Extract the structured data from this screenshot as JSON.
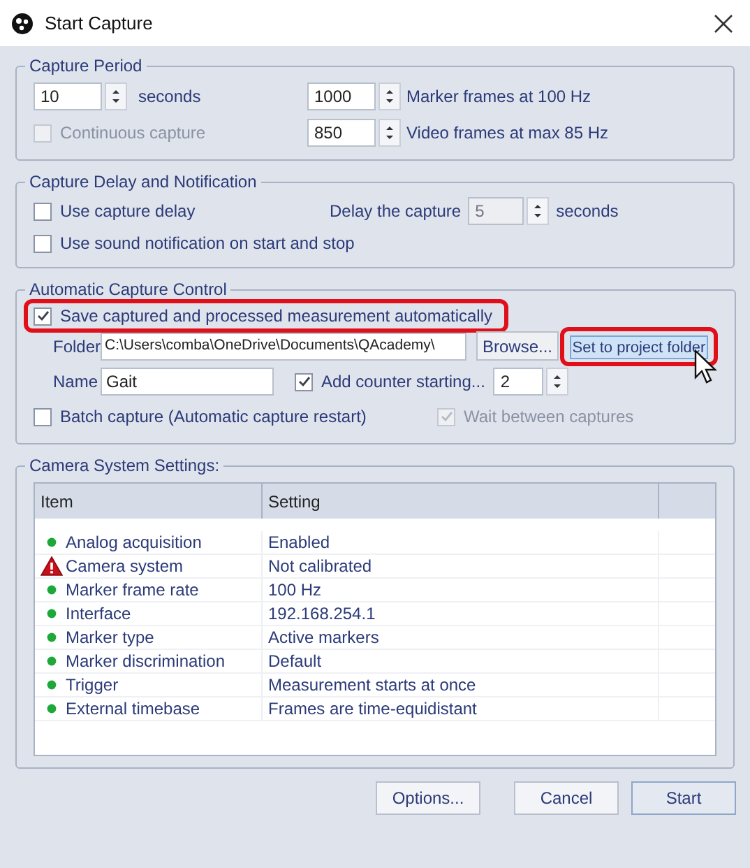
{
  "window": {
    "title": "Start Capture"
  },
  "capture_period": {
    "title": "Capture Period",
    "seconds": {
      "value": "10",
      "unit": "seconds"
    },
    "continuous": {
      "label": "Continuous capture",
      "checked": false,
      "disabled": true
    },
    "marker_frames": {
      "value": "1000",
      "label": "Marker frames at 100 Hz"
    },
    "video_frames": {
      "value": "850",
      "label": "Video frames at max 85 Hz"
    }
  },
  "delay": {
    "title": "Capture Delay and Notification",
    "use_delay": {
      "label": "Use capture delay",
      "checked": false,
      "disabled": false
    },
    "sound": {
      "label": "Use sound notification on start and stop",
      "checked": false,
      "disabled": false
    },
    "delay_label": "Delay the capture",
    "delay_value": {
      "value": "5",
      "disabled": true
    },
    "delay_unit": "seconds"
  },
  "auto": {
    "title": "Automatic Capture Control",
    "save": {
      "label": "Save captured and processed measurement automatically",
      "checked": true,
      "disabled": false,
      "highlighted": true
    },
    "folder_label": "Folder",
    "folder_value": "C:\\Users\\comba\\OneDrive\\Documents\\QAcademy\\",
    "browse": "Browse...",
    "set_project": {
      "label": "Set to project folder",
      "highlighted": true
    },
    "name_label": "Name",
    "name_value": "Gait",
    "counter": {
      "label": "Add counter starting...",
      "checked": true,
      "disabled": false
    },
    "counter_value": "2",
    "batch": {
      "label": "Batch capture (Automatic capture restart)",
      "checked": false,
      "disabled": false
    },
    "wait": {
      "label": "Wait between captures",
      "checked": true,
      "disabled": true
    }
  },
  "camera": {
    "title": "Camera System Settings:",
    "columns": [
      "Item",
      "Setting"
    ],
    "rows": [
      {
        "kind": "ok",
        "item": "Analog acquisition",
        "setting": "Enabled"
      },
      {
        "kind": "warning",
        "item": "Camera system",
        "setting": "Not calibrated"
      },
      {
        "kind": "ok",
        "item": "Marker frame rate",
        "setting": "100 Hz"
      },
      {
        "kind": "ok",
        "item": "Interface",
        "setting": "192.168.254.1"
      },
      {
        "kind": "ok",
        "item": "Marker type",
        "setting": "Active markers"
      },
      {
        "kind": "ok",
        "item": "Marker discrimination",
        "setting": "Default"
      },
      {
        "kind": "ok",
        "item": "Trigger",
        "setting": "Measurement starts at once"
      },
      {
        "kind": "ok",
        "item": "External timebase",
        "setting": "Frames are time-equidistant"
      }
    ]
  },
  "buttons": [
    {
      "label": "Options...",
      "default": false
    },
    {
      "label": "Cancel",
      "default": false
    },
    {
      "label": "Start",
      "default": true
    }
  ]
}
